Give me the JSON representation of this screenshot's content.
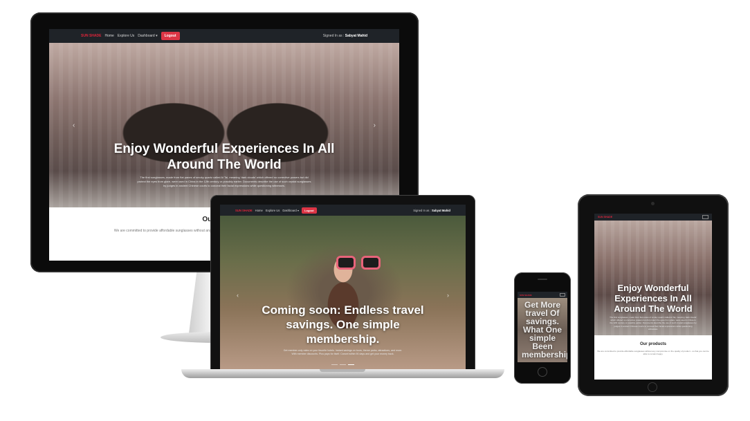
{
  "site": {
    "brand": "SUN SHADE",
    "nav_home": "Home",
    "nav_explore": "Explore Us",
    "nav_dashboard": "Dashboard ▾",
    "logout": "Logout",
    "signed_in_prefix": "Signed In as :",
    "signed_in_user": "Sabyat Mahid"
  },
  "desktop": {
    "hero_title": "Enjoy Wonderful Experiences In All Around The World",
    "hero_text": "The first sunglasses, made from flat panes of smoky quartz called Ai Tai, meaning 'dark clouds' which offered no corrective powers but did protect the eyes from glare, were used in China in the 12th century or possibly earlier. Documents describe the use of such crystal sunglasses by judges in ancient Chinese courts to conceal their facial expressions while questioning witnesses.",
    "section_title": "Our products",
    "section_sub": "We are committed to provide affordable sunglasses without any compromise on the quality of product - so that you can be able to remain happy."
  },
  "laptop": {
    "hero_title": "Coming soon: Endless travel savings. One simple membership.",
    "hero_text": "Get member-only rates on your favorite hotels. Instant savings on tours, theme parks, attractions, and more. With member discounts. Plus pays for itself. Cancel within 90 days and get your money back."
  },
  "phone": {
    "hero_title": "Get More travel Of savings. What One simple Been membership"
  },
  "tablet": {
    "hero_title": "Enjoy Wonderful Experiences In All Around The World",
    "hero_text": "The first sunglasses, made from flat panes of smoky quartz called Ai Tai, meaning 'dark clouds' which offered no corrective powers but did protect the eyes from glare, were used in China in the 12th century or possibly earlier. Documents describe the use of such crystal sunglasses by judges in ancient Chinese courts to conceal their facial expressions while questioning witnesses.",
    "section_title": "Our products",
    "section_sub": "We are committed to provide affordable sunglasses without any compromise on the quality of product - so that you can be able to remain happy."
  },
  "icons": {
    "prev": "‹",
    "next": "›"
  },
  "colors": {
    "brand": "#e0243a",
    "logout": "#dc3545",
    "navbar": "#1f2328"
  }
}
